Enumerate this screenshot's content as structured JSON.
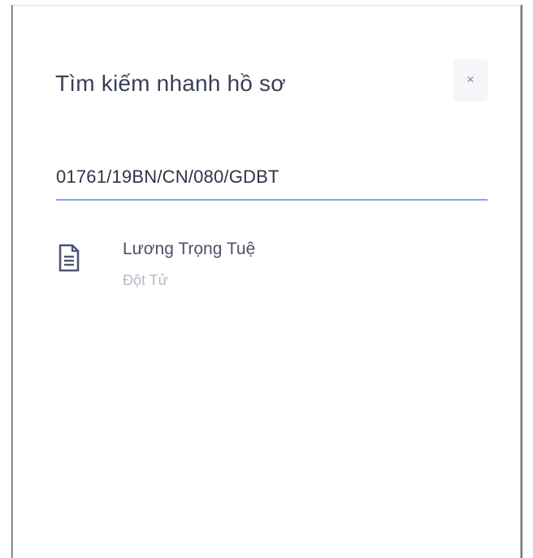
{
  "dialog": {
    "title": "Tìm kiếm nhanh hồ sơ",
    "close_label": "×",
    "close_icon": "close-icon"
  },
  "search": {
    "value": "01761/19BN/CN/080/GDBT",
    "placeholder": ""
  },
  "results": [
    {
      "icon": "document-icon",
      "title": "Lương Trọng Tuệ",
      "subtitle": "Đột Tử"
    }
  ],
  "colors": {
    "title": "#3a3f58",
    "input_underline": "#8aa0f3",
    "icon": "#4b5574",
    "subtitle": "#b6b9c8",
    "close_bg": "#f5f6f9"
  }
}
